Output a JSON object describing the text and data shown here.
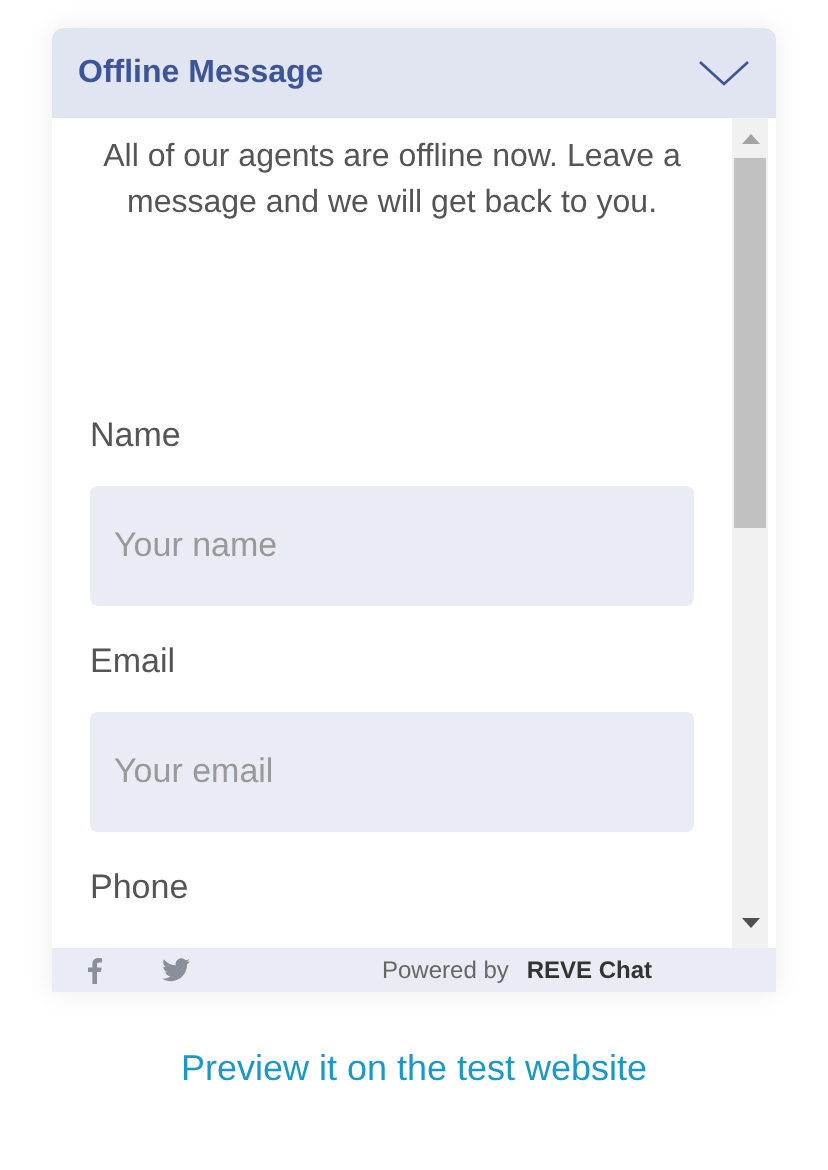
{
  "header": {
    "title": "Offline Message"
  },
  "message": "All of our agents are offline now. Leave a message and we will get back to you.",
  "fields": [
    {
      "label": "Name",
      "placeholder": "Your name",
      "kind": "input"
    },
    {
      "label": "Email",
      "placeholder": "Your email",
      "kind": "input"
    },
    {
      "label": "Phone",
      "kind": "label"
    }
  ],
  "footer": {
    "powered_by": "Powered by",
    "brand": "REVE Chat"
  },
  "preview_link": "Preview it on the test website"
}
